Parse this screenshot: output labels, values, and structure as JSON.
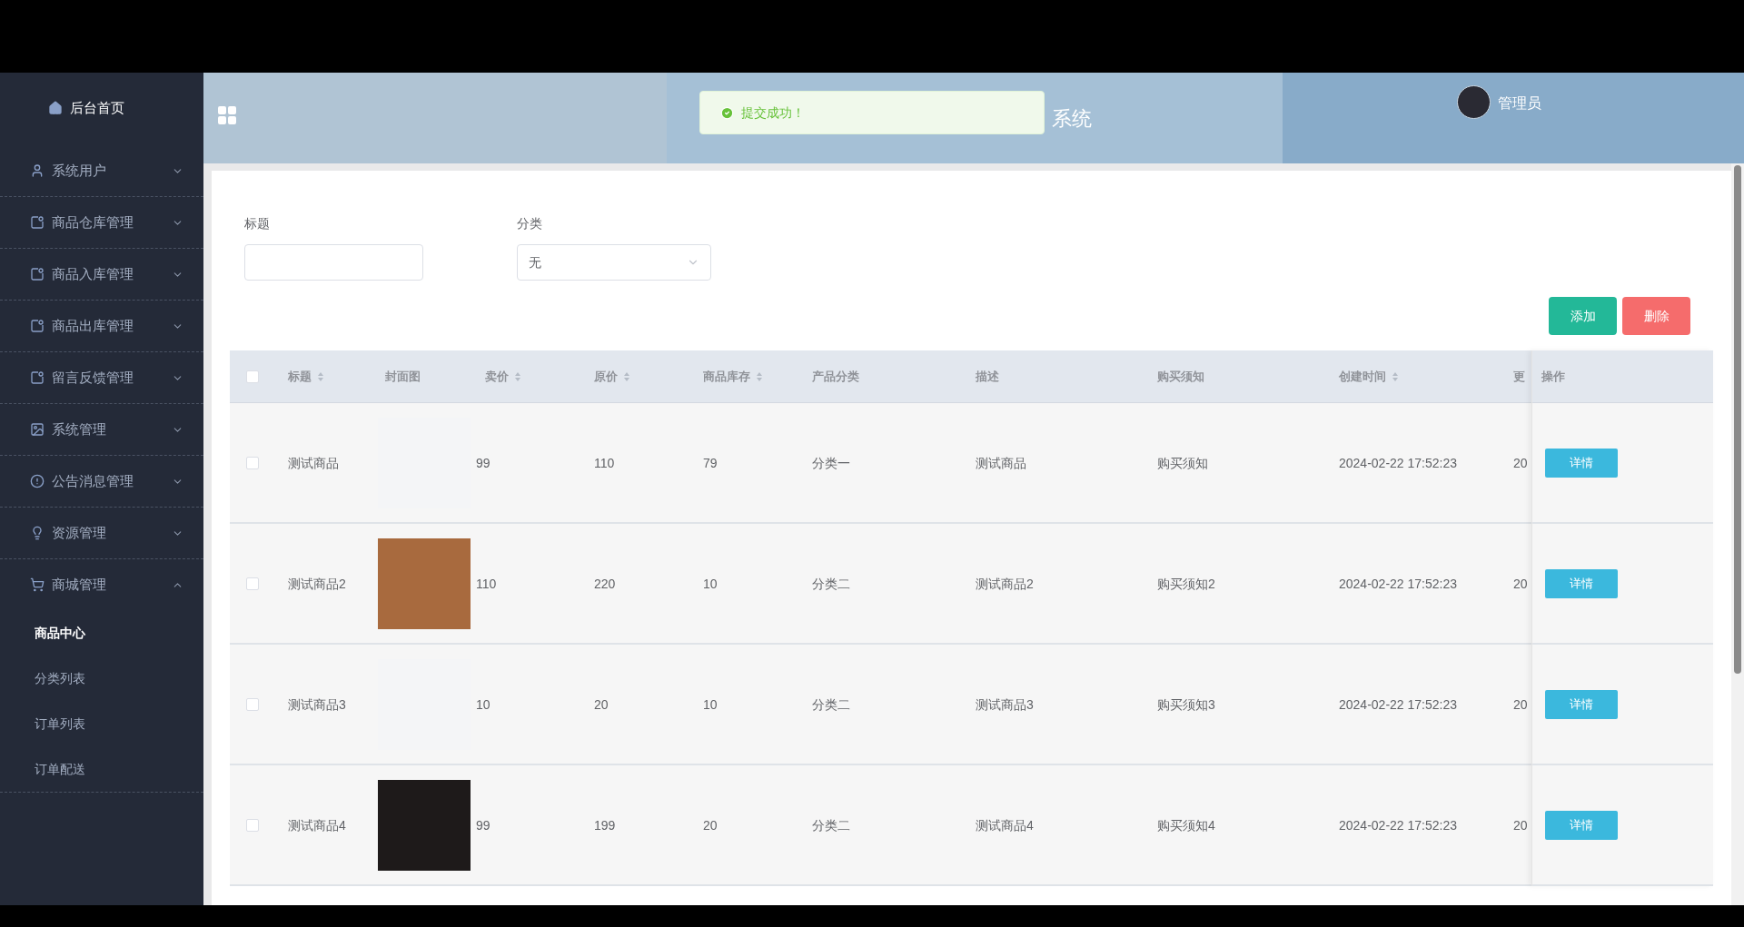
{
  "sidebar": {
    "home": "后台首页",
    "items": [
      {
        "label": "系统用户",
        "expanded": false
      },
      {
        "label": "商品仓库管理",
        "expanded": false
      },
      {
        "label": "商品入库管理",
        "expanded": false
      },
      {
        "label": "商品出库管理",
        "expanded": false
      },
      {
        "label": "留言反馈管理",
        "expanded": false
      },
      {
        "label": "系统管理",
        "expanded": false
      },
      {
        "label": "公告消息管理",
        "expanded": false
      },
      {
        "label": "资源管理",
        "expanded": false
      },
      {
        "label": "商城管理",
        "expanded": true,
        "children": [
          {
            "label": "商品中心",
            "selected": true
          },
          {
            "label": "分类列表",
            "selected": false
          },
          {
            "label": "订单列表",
            "selected": false
          },
          {
            "label": "订单配送",
            "selected": false
          }
        ]
      }
    ]
  },
  "header": {
    "title": "系统",
    "user": "管理员"
  },
  "toast": {
    "text": "提交成功！"
  },
  "filters": [
    {
      "label": "标题",
      "kind": "input"
    },
    {
      "label": "分类",
      "kind": "select",
      "value": "无"
    }
  ],
  "actions": [
    {
      "label": "添加",
      "kind": "add"
    },
    {
      "label": "删除",
      "kind": "delete"
    }
  ],
  "table": {
    "select_all": false,
    "columns": [
      {
        "label": "标题",
        "sortable": true
      },
      {
        "label": "封面图",
        "sortable": false
      },
      {
        "label": "卖价",
        "sortable": true
      },
      {
        "label": "原价",
        "sortable": true
      },
      {
        "label": "商品库存",
        "sortable": true
      },
      {
        "label": "产品分类",
        "sortable": false
      },
      {
        "label": "描述",
        "sortable": false
      },
      {
        "label": "购买须知",
        "sortable": false
      },
      {
        "label": "创建时间",
        "sortable": true
      },
      {
        "label": "更"
      },
      {
        "label": "操作",
        "sortable": false
      }
    ],
    "rows": [
      {
        "checked": false,
        "cover": false,
        "cells": [
          "测试商品",
          "",
          "99",
          "110",
          "79",
          "分类一",
          "测试商品",
          "购买须知",
          "2024-02-22 17:52:23",
          "20",
          "详情"
        ]
      },
      {
        "checked": false,
        "cover": true,
        "cells": [
          "测试商品2",
          "",
          "110",
          "220",
          "10",
          "分类二",
          "测试商品2",
          "购买须知2",
          "2024-02-22 17:52:23",
          "20",
          "详情"
        ]
      },
      {
        "checked": false,
        "cover": false,
        "cells": [
          "测试商品3",
          "",
          "10",
          "20",
          "10",
          "分类二",
          "测试商品3",
          "购买须知3",
          "2024-02-22 17:52:23",
          "20",
          "详情"
        ]
      },
      {
        "checked": false,
        "cover": true,
        "cells": [
          "测试商品4",
          "",
          "99",
          "199",
          "20",
          "分类二",
          "测试商品4",
          "购买须知4",
          "2024-02-22 17:52:23",
          "20",
          "详情"
        ]
      }
    ]
  }
}
